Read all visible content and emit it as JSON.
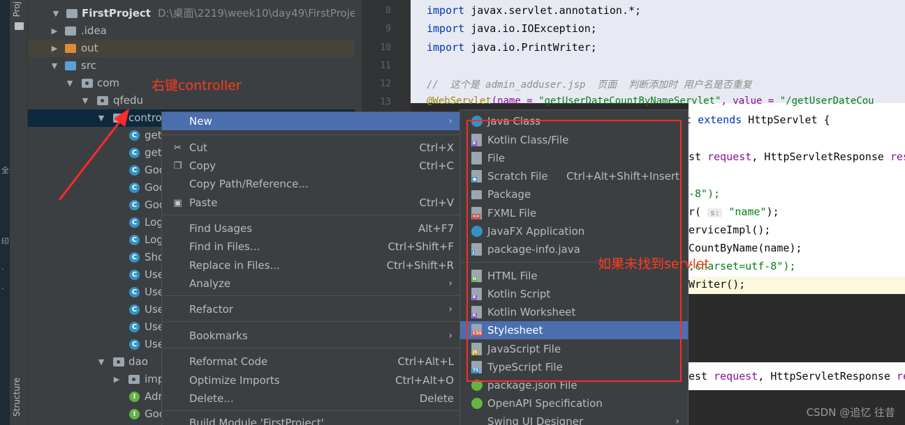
{
  "tool_stripe": {
    "top_label": "Proj",
    "bottom_label": "Structure"
  },
  "desk_strip_chars": [
    "全",
    "印",
    "·",
    "·"
  ],
  "tree": {
    "root_label": "FirstProject",
    "root_path": "D:\\桌面\\2219\\week10\\day49\\FirstProject",
    "idea": ".idea",
    "out": "out",
    "src": "src",
    "com": "com",
    "qfedu": "qfedu",
    "controller": "contro",
    "controller_children": [
      "get",
      "get",
      "Goo",
      "Goo",
      "Goo",
      "Log",
      "Log",
      "Sho",
      "Use",
      "Use",
      "Use",
      "Use",
      "Use"
    ],
    "dao": "dao",
    "dao_children": [
      {
        "label": "imp",
        "kind": "folder"
      },
      {
        "label": "Adr",
        "kind": "interface"
      },
      {
        "label": "Goo",
        "kind": "interface"
      }
    ]
  },
  "editor": {
    "line_numbers": [
      "8",
      "9",
      "10",
      "11",
      "12",
      "13"
    ],
    "line8": {
      "kw": "import",
      "rest": " javax.servlet.annotation.*;"
    },
    "line9": {
      "kw": "import",
      "rest": " java.io.IOException;"
    },
    "line10": {
      "kw": "import",
      "rest": " java.io.PrintWriter;"
    },
    "line12_comment": "//  这个是 admin_adduser.jsp  页面  判断添加时 用户名是否重复",
    "line13_ann": "@WebServlet",
    "line13_rest": "(name = ",
    "line13_str1": "\"getUserDateCountByNameServlet\"",
    "line13_mid": ", value = ",
    "line13_str2": "\"/getUserDateCou",
    "frag_extends": "t ",
    "frag_extends_kw": "extends",
    "frag_extends_rest": " HttpServlet {",
    "frag_req1": "st ",
    "frag_req1_par": "request",
    "frag_req1_rest": ", HttpServletResponse ",
    "frag_req1_par2": "res",
    "frag_utf8": "-8\");",
    "frag_param_a": "r( ",
    "frag_param_hint": "s:",
    "frag_param_str": " \"name\"",
    "frag_param_b": ");",
    "frag_impl": "erviceImpl();",
    "frag_countbyname": "CountByName(name);",
    "frag_charset": ";charset=utf-8\");",
    "frag_writer": "Writer();",
    "frag_req2": "est ",
    "frag_req2_par": "request",
    "frag_req2_rest": ", HttpServletResponse ",
    "frag_req2_par2": "re"
  },
  "main_menu": {
    "new": "New",
    "cut": "Cut",
    "cut_sc": "Ctrl+X",
    "copy": "Copy",
    "copy_sc": "Ctrl+C",
    "copy_path": "Copy Path/Reference...",
    "paste": "Paste",
    "paste_sc": "Ctrl+V",
    "find_usages": "Find Usages",
    "find_usages_sc": "Alt+F7",
    "find_in_files": "Find in Files...",
    "find_in_files_sc": "Ctrl+Shift+F",
    "replace_in_files": "Replace in Files...",
    "replace_in_files_sc": "Ctrl+Shift+R",
    "analyze": "Analyze",
    "refactor": "Refactor",
    "bookmarks": "Bookmarks",
    "reformat": "Reformat Code",
    "reformat_sc": "Ctrl+Alt+L",
    "optimize": "Optimize Imports",
    "optimize_sc": "Ctrl+Alt+O",
    "delete": "Delete...",
    "delete_sc": "Delete",
    "build": "Build Module 'FirstProject'"
  },
  "sub_menu": {
    "java_class": "Java Class",
    "kotlin_class": "Kotlin Class/File",
    "file": "File",
    "scratch": "Scratch File",
    "scratch_sc": "Ctrl+Alt+Shift+Insert",
    "package": "Package",
    "fxml": "FXML File",
    "javafx": "JavaFX Application",
    "package_info": "package-info.java",
    "html": "HTML File",
    "kotlin_script": "Kotlin Script",
    "kotlin_worksheet": "Kotlin Worksheet",
    "stylesheet": "Stylesheet",
    "javascript": "JavaScript File",
    "typescript": "TypeScript File",
    "package_json": "package.json File",
    "openapi": "OpenAPI Specification",
    "swing": "Swing UI Designer"
  },
  "annotations": {
    "right_click": "右键controller",
    "not_found": "如果未找到servlet"
  },
  "watermark": "CSDN @追忆 往昔",
  "colors": {
    "accent_selection": "#4b6eaf",
    "annotation_red": "#ff2a2a"
  }
}
